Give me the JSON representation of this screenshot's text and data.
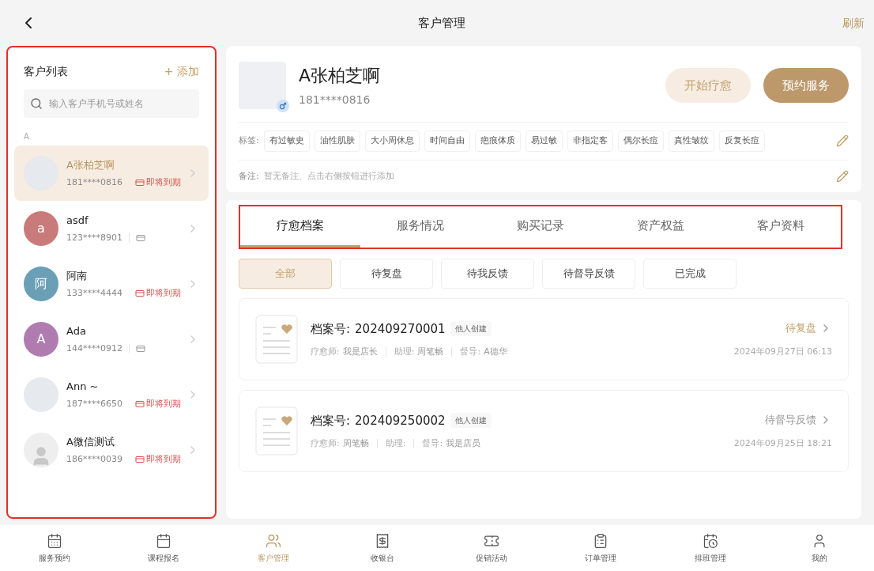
{
  "header": {
    "title": "客户管理",
    "action": "刷新"
  },
  "sidebar": {
    "title": "客户列表",
    "add": "+ 添加",
    "search_placeholder": "输入客户手机号或姓名",
    "group": "A",
    "customers": [
      {
        "name": "A张柏芝啊",
        "phone": "181****0816",
        "badge": "即将到期",
        "selected": true,
        "avatar": {
          "kind": "photo"
        }
      },
      {
        "name": "asdf",
        "phone": "123****8901",
        "selected": false,
        "avatar": {
          "kind": "letter",
          "text": "a",
          "color": "#c97a7a"
        }
      },
      {
        "name": "阿南",
        "phone": "133****4444",
        "badge": "即将到期",
        "selected": false,
        "avatar": {
          "kind": "letter",
          "text": "阿",
          "color": "#6a9fb5"
        }
      },
      {
        "name": "Ada",
        "phone": "144****0912",
        "selected": false,
        "avatar": {
          "kind": "letter",
          "text": "A",
          "color": "#b07cb0"
        }
      },
      {
        "name": "Ann ~",
        "phone": "187****6650",
        "badge": "即将到期",
        "selected": false,
        "avatar": {
          "kind": "photo"
        }
      },
      {
        "name": "A微信测试",
        "phone": "186****0039",
        "badge": "即将到期",
        "selected": false,
        "avatar": {
          "kind": "default"
        }
      }
    ]
  },
  "profile": {
    "name": "A张柏芝啊",
    "phone": "181****0816",
    "buttons": [
      {
        "label": "开始疗愈",
        "kind": "secondary"
      },
      {
        "label": "预约服务",
        "kind": "primary"
      }
    ],
    "tags_label": "标签:",
    "tags": [
      "有过敏史",
      "油性肌肤",
      "大小周休息",
      "时间自由",
      "疤痕体质",
      "易过敏",
      "非指定客",
      "偶尔长痘",
      "真性皱纹",
      "反复长痘"
    ],
    "note_label": "备注:",
    "note": "暂无备注、点击右侧按钮进行添加"
  },
  "tabs": [
    {
      "label": "疗愈档案",
      "selected": true
    },
    {
      "label": "服务情况",
      "selected": false
    },
    {
      "label": "购买记录",
      "selected": false
    },
    {
      "label": "资产权益",
      "selected": false
    },
    {
      "label": "客户资料",
      "selected": false
    }
  ],
  "filters": [
    {
      "label": "全部",
      "selected": true
    },
    {
      "label": "待复盘",
      "selected": false
    },
    {
      "label": "待我反馈",
      "selected": false
    },
    {
      "label": "待督导反馈",
      "selected": false
    },
    {
      "label": "已完成",
      "selected": false
    }
  ],
  "records": [
    {
      "label": "档案号:",
      "number": "202409270001",
      "badge": "他人创建",
      "meta": [
        {
          "label": "疗愈师:",
          "value": "我是店长"
        },
        {
          "label": "助理:",
          "value": "周笔畅"
        },
        {
          "label": "督导:",
          "value": "A德华"
        }
      ],
      "status": "待复盘",
      "highlight": true,
      "date": "2024年09月27日 06:13"
    },
    {
      "label": "档案号:",
      "number": "202409250002",
      "badge": "他人创建",
      "meta": [
        {
          "label": "疗愈师:",
          "value": "周笔畅"
        },
        {
          "label": "助理:"
        },
        {
          "label": "督导:",
          "value": "我是店员"
        }
      ],
      "status": "待督导反馈",
      "highlight": false,
      "date": "2024年09月25日 18:21"
    }
  ],
  "bottom_nav": [
    {
      "label": "服务预约",
      "selected": false
    },
    {
      "label": "课程报名",
      "selected": false
    },
    {
      "label": "客户管理",
      "selected": true
    },
    {
      "label": "收银台",
      "selected": false
    },
    {
      "label": "促销活动",
      "selected": false
    },
    {
      "label": "订单管理",
      "selected": false
    },
    {
      "label": "排班管理",
      "selected": false
    },
    {
      "label": "我的",
      "selected": false
    }
  ]
}
